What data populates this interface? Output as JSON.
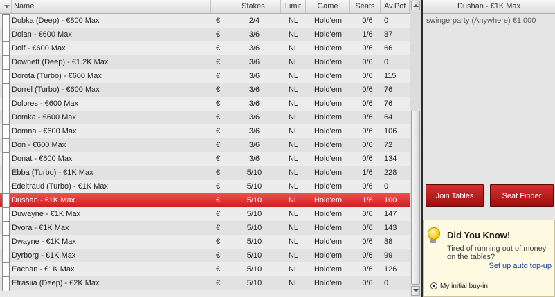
{
  "columns": {
    "name": "Name",
    "stakes": "Stakes",
    "limit": "Limit",
    "game": "Game",
    "seats": "Seats",
    "avpot": "Av.Pot"
  },
  "rows": [
    {
      "name": "Dobka (Deep) - €800 Max",
      "cur": "€",
      "stakes": "2/4",
      "limit": "NL",
      "game": "Hold'em",
      "seats": "0/6",
      "pot": "0"
    },
    {
      "name": "Dolan - €600 Max",
      "cur": "€",
      "stakes": "3/6",
      "limit": "NL",
      "game": "Hold'em",
      "seats": "1/6",
      "pot": "87"
    },
    {
      "name": "Dolf - €600 Max",
      "cur": "€",
      "stakes": "3/6",
      "limit": "NL",
      "game": "Hold'em",
      "seats": "0/6",
      "pot": "66"
    },
    {
      "name": "Downett (Deep) - €1.2K Max",
      "cur": "€",
      "stakes": "3/6",
      "limit": "NL",
      "game": "Hold'em",
      "seats": "0/6",
      "pot": "0"
    },
    {
      "name": "Dorota (Turbo) - €600 Max",
      "cur": "€",
      "stakes": "3/6",
      "limit": "NL",
      "game": "Hold'em",
      "seats": "0/6",
      "pot": "115"
    },
    {
      "name": "Dorrel (Turbo) - €600 Max",
      "cur": "€",
      "stakes": "3/6",
      "limit": "NL",
      "game": "Hold'em",
      "seats": "0/6",
      "pot": "76"
    },
    {
      "name": "Dolores - €600 Max",
      "cur": "€",
      "stakes": "3/6",
      "limit": "NL",
      "game": "Hold'em",
      "seats": "0/6",
      "pot": "76"
    },
    {
      "name": "Domka - €600 Max",
      "cur": "€",
      "stakes": "3/6",
      "limit": "NL",
      "game": "Hold'em",
      "seats": "0/6",
      "pot": "64"
    },
    {
      "name": "Domna - €600 Max",
      "cur": "€",
      "stakes": "3/6",
      "limit": "NL",
      "game": "Hold'em",
      "seats": "0/6",
      "pot": "106"
    },
    {
      "name": "Don - €600 Max",
      "cur": "€",
      "stakes": "3/6",
      "limit": "NL",
      "game": "Hold'em",
      "seats": "0/6",
      "pot": "72"
    },
    {
      "name": "Donat - €600 Max",
      "cur": "€",
      "stakes": "3/6",
      "limit": "NL",
      "game": "Hold'em",
      "seats": "0/6",
      "pot": "134"
    },
    {
      "name": "Ebba (Turbo) - €1K Max",
      "cur": "€",
      "stakes": "5/10",
      "limit": "NL",
      "game": "Hold'em",
      "seats": "1/6",
      "pot": "228"
    },
    {
      "name": "Edeltraud (Turbo) - €1K Max",
      "cur": "€",
      "stakes": "5/10",
      "limit": "NL",
      "game": "Hold'em",
      "seats": "0/6",
      "pot": "0"
    },
    {
      "name": "Dushan - €1K Max",
      "cur": "€",
      "stakes": "5/10",
      "limit": "NL",
      "game": "Hold'em",
      "seats": "1/6",
      "pot": "100",
      "selected": true
    },
    {
      "name": "Duwayne - €1K Max",
      "cur": "€",
      "stakes": "5/10",
      "limit": "NL",
      "game": "Hold'em",
      "seats": "0/6",
      "pot": "147"
    },
    {
      "name": "Dvora - €1K Max",
      "cur": "€",
      "stakes": "5/10",
      "limit": "NL",
      "game": "Hold'em",
      "seats": "0/6",
      "pot": "143"
    },
    {
      "name": "Dwayne - €1K Max",
      "cur": "€",
      "stakes": "5/10",
      "limit": "NL",
      "game": "Hold'em",
      "seats": "0/6",
      "pot": "88"
    },
    {
      "name": "Dyrborg - €1K Max",
      "cur": "€",
      "stakes": "5/10",
      "limit": "NL",
      "game": "Hold'em",
      "seats": "0/6",
      "pot": "99"
    },
    {
      "name": "Eachan - €1K Max",
      "cur": "€",
      "stakes": "5/10",
      "limit": "NL",
      "game": "Hold'em",
      "seats": "0/6",
      "pot": "126"
    },
    {
      "name": "Efrasiia (Deep) - €2K Max",
      "cur": "€",
      "stakes": "5/10",
      "limit": "NL",
      "game": "Hold'em",
      "seats": "0/6",
      "pot": "0"
    }
  ],
  "detail": {
    "title": "Dushan - €1K Max",
    "players": [
      {
        "text": "swingerparty (Anywhere) €1,000"
      }
    ]
  },
  "buttons": {
    "join": "Join Tables",
    "seat_finder": "Seat Finder"
  },
  "did_you_know": {
    "title": "Did You Know!",
    "text": "Tired of running out of money on the tables?",
    "link": "Set up auto top-up",
    "option": "My initial buy-in"
  },
  "colors": {
    "selected_row": "#dd3333",
    "button_red": "#c02020"
  },
  "icons": {
    "tip": "lightbulb-icon"
  }
}
